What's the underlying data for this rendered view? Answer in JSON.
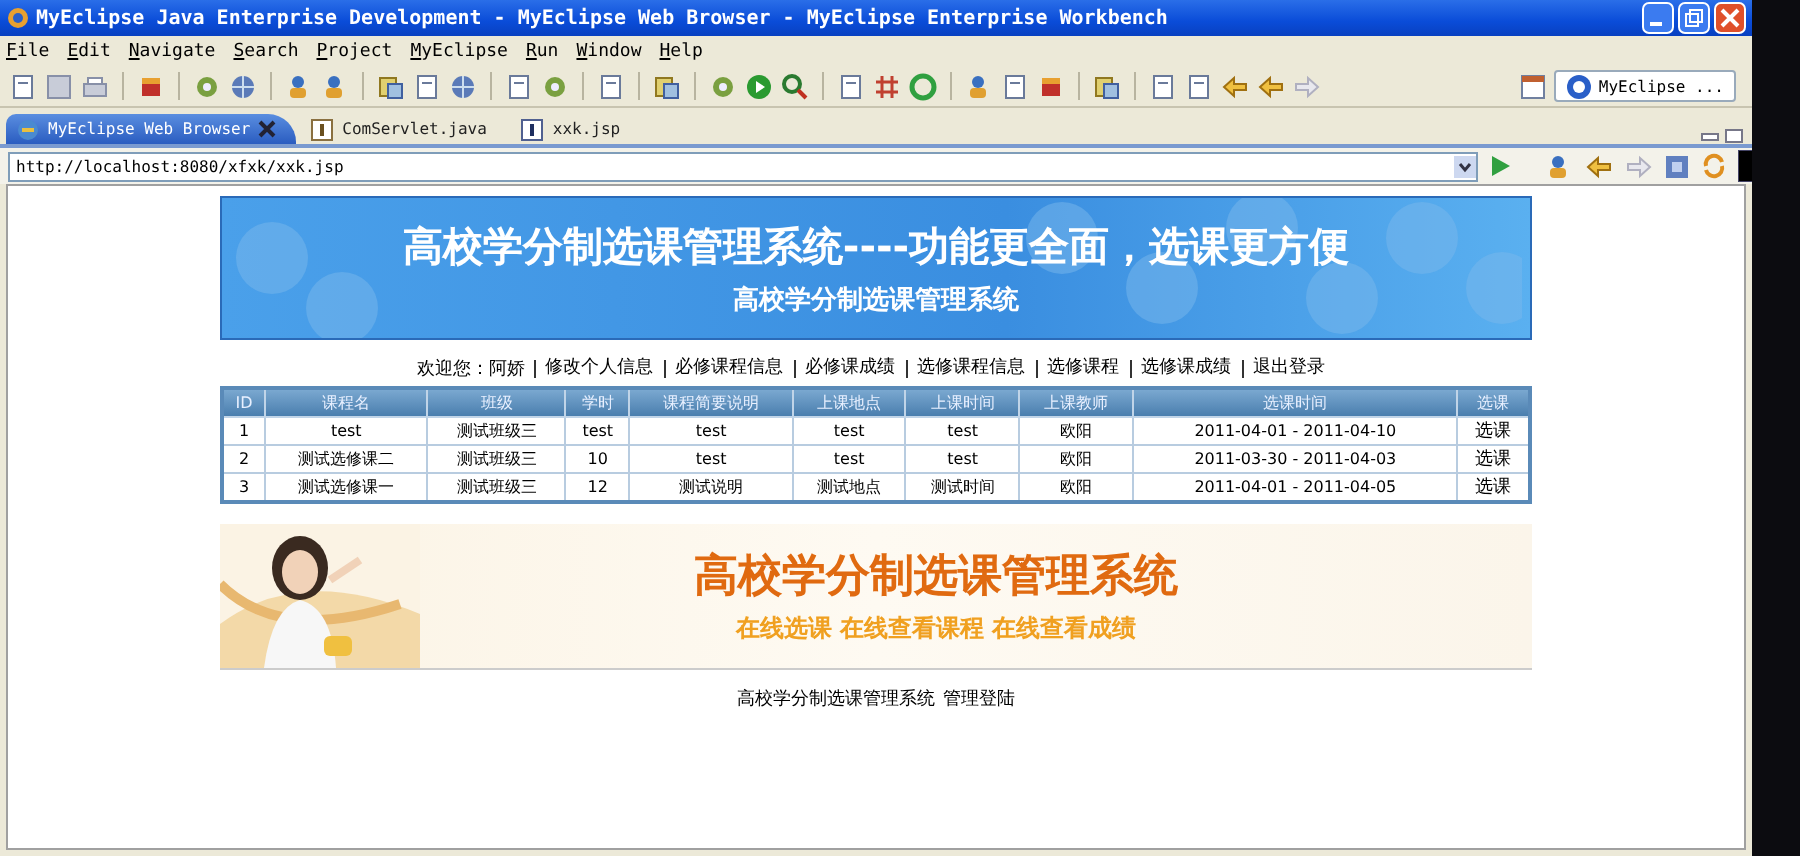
{
  "window": {
    "title": "MyEclipse Java Enterprise Development - MyEclipse Web Browser - MyEclipse Enterprise Workbench"
  },
  "menu": [
    "File",
    "Edit",
    "Navigate",
    "Search",
    "Project",
    "MyEclipse",
    "Run",
    "Window",
    "Help"
  ],
  "perspective": {
    "label": "MyEclipse ..."
  },
  "editor_tabs": [
    {
      "label": "MyEclipse Web Browser",
      "selected": true,
      "kind": "browser"
    },
    {
      "label": "ComServlet.java",
      "selected": false,
      "kind": "java"
    },
    {
      "label": "xxk.jsp",
      "selected": false,
      "kind": "jsp"
    }
  ],
  "address_bar": {
    "value": "http://localhost:8080/xfxk/xxk.jsp"
  },
  "page": {
    "header_banner": {
      "title": "高校学分制选课管理系统----功能更全面，选课更方便",
      "subtitle": "高校学分制选课管理系统"
    },
    "nav": {
      "welcome": "欢迎您：阿娇",
      "links": [
        "修改个人信息",
        "必修课程信息",
        "必修课成绩",
        "选修课程信息",
        "选修课程",
        "选修课成绩",
        "退出登录"
      ]
    },
    "table": {
      "columns": [
        "ID",
        "课程名",
        "班级",
        "学时",
        "课程简要说明",
        "上课地点",
        "上课时间",
        "上课教师",
        "选课时间",
        "选课"
      ],
      "rows": [
        [
          "1",
          "test",
          "测试班级三",
          "test",
          "test",
          "test",
          "test",
          "欧阳",
          "2011-04-01 - 2011-04-10",
          "选课"
        ],
        [
          "2",
          "测试选修课二",
          "测试班级三",
          "10",
          "test",
          "test",
          "test",
          "欧阳",
          "2011-03-30 - 2011-04-03",
          "选课"
        ],
        [
          "3",
          "测试选修课一",
          "测试班级三",
          "12",
          "测试说明",
          "测试地点",
          "测试时间",
          "欧阳",
          "2011-04-01 - 2011-04-05",
          "选课"
        ]
      ]
    },
    "promo_banner": {
      "title": "高校学分制选课管理系统",
      "tagline": "在线选课 在线查看课程 在线查看成绩"
    },
    "footer": {
      "text": "高校学分制选课管理系统",
      "link": "管理登陆"
    }
  }
}
